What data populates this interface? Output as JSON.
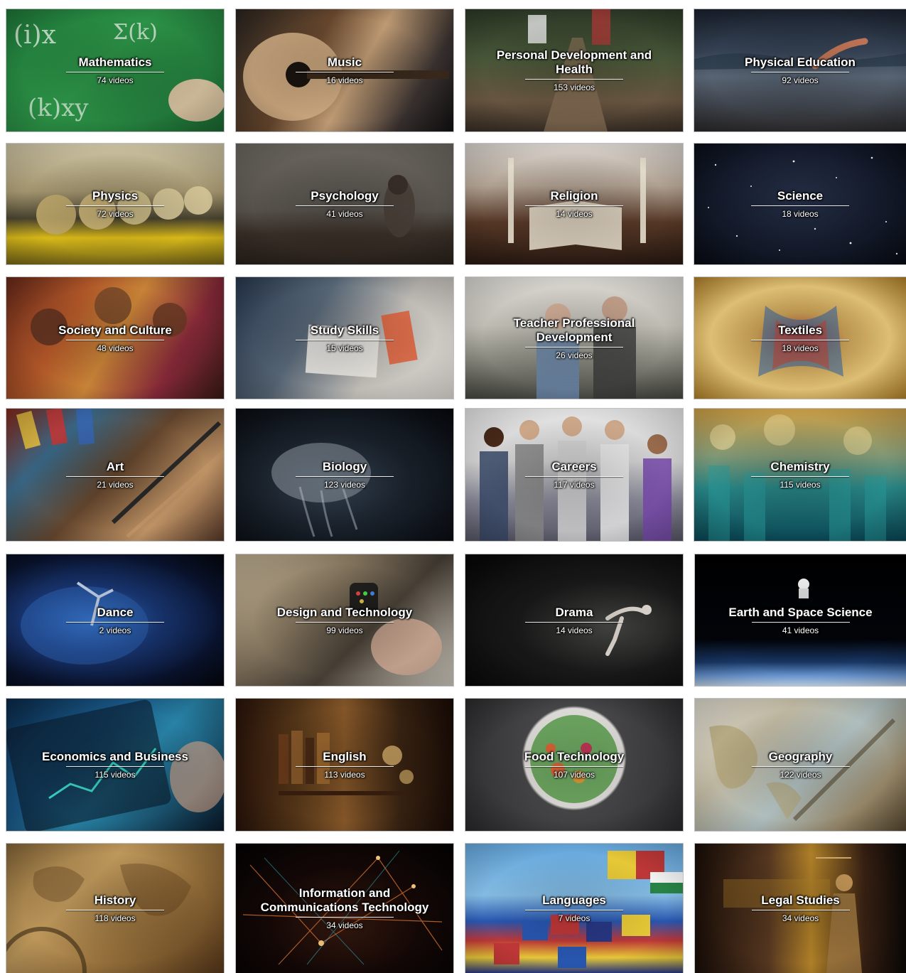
{
  "tiles": [
    {
      "title": "Mathematics",
      "count": "74 videos",
      "bg": "linear-gradient(135deg,#1f7a3a 0%,#2e9a4a 45%,#1c6a33 100%)",
      "accent": "#e9f5e9",
      "icon": "chalkboard-icon"
    },
    {
      "title": "Music",
      "count": "16 videos",
      "bg": "linear-gradient(120deg,#2b2520 0%,#6b4a2f 35%,#c9a37a 55%,#3a3230 80%,#121212 100%)",
      "accent": "#d8b48a",
      "icon": "guitar-icon"
    },
    {
      "title": "Personal Development and Health",
      "count": "153 videos",
      "bg": "linear-gradient(180deg,#2f3b28 0%,#4a5a3a 40%,#6e5a44 75%,#3a3026 100%)",
      "accent": "#b7c8a0",
      "icon": "runner-icon"
    },
    {
      "title": "Physical Education",
      "count": "92 videos",
      "bg": "linear-gradient(180deg,#1b2330 0%,#39475a 35%,#5d6a7a 55%,#2c2a2c 100%)",
      "accent": "#c97a5a",
      "icon": "swimmer-icon"
    },
    {
      "title": "Physics",
      "count": "72 videos",
      "bg": "linear-gradient(180deg,#d9cfae 0%,#a99a72 40%,#4a4430 62%,#e3c21a 78%,#7a6a18 100%)",
      "accent": "#f0d84a",
      "icon": "newtons-cradle-icon"
    },
    {
      "title": "Psychology",
      "count": "41 videos",
      "bg": "linear-gradient(180deg,#6f6a63 0%,#5a554f 55%,#3a3028 75%,#2a221c 100%)",
      "accent": "#9a8f80",
      "icon": "person-icon"
    },
    {
      "title": "Religion",
      "count": "14 videos",
      "bg": "linear-gradient(180deg,#e6e0da 0%,#b8a898 35%,#5a3a28 65%,#2a1a12 100%)",
      "accent": "#f2ead8",
      "icon": "book-icon"
    },
    {
      "title": "Science",
      "count": "18 videos",
      "bg": "radial-gradient(ellipse at 50% 45%,#2a3550 0%,#141b2c 55%,#080b14 100%)",
      "accent": "#ffffff",
      "icon": "star-icon"
    },
    {
      "title": "Society and Culture",
      "count": "48 videos",
      "bg": "linear-gradient(120deg,#6a2a1a 0%,#b85a2a 30%,#d28a3a 50%,#8a2a3a 75%,#3a1a14 100%)",
      "accent": "#e8b070",
      "icon": "people-icon"
    },
    {
      "title": "Study Skills",
      "count": "15 videos",
      "bg": "linear-gradient(120deg,#2a3a52 0%,#5a6a7a 35%,#c8c4be 65%,#e8e4de 100%)",
      "accent": "#e8623a",
      "icon": "notebook-icon"
    },
    {
      "title": "Teacher Professional Development",
      "count": "26 videos",
      "bg": "linear-gradient(180deg,#e4e2dc 0%,#c8c6bc 40%,#8a8a80 70%,#4a4a44 100%)",
      "accent": "#6a8ab0",
      "icon": "meeting-icon"
    },
    {
      "title": "Textiles",
      "count": "18 videos",
      "bg": "radial-gradient(ellipse at 50% 50%,#c84a3a 0%,#d2a85a 30%,#e8c87a 60%,#b8862a 100%)",
      "accent": "#3a6aa8",
      "icon": "fabric-icon"
    },
    {
      "title": "Art",
      "count": "21 videos",
      "bg": "linear-gradient(135deg,#8a2a1a 0%,#3a6a8a 25%,#6a4a30 50%,#c89a6a 75%,#5a3a2a 100%)",
      "accent": "#e8c040",
      "icon": "paintbrush-icon"
    },
    {
      "title": "Biology",
      "count": "123 videos",
      "bg": "radial-gradient(ellipse at 45% 55%,#3a4a5a 0%,#1a222c 45%,#06080c 100%)",
      "accent": "#dfe8f0",
      "icon": "jellyfish-icon"
    },
    {
      "title": "Careers",
      "count": "117 videos",
      "bg": "linear-gradient(180deg,#f2f2f2 0%,#d8d8d8 40%,#8a8a9a 70%,#5a5a6a 100%)",
      "accent": "#7a4ab0",
      "icon": "workers-icon"
    },
    {
      "title": "Chemistry",
      "count": "115 videos",
      "bg": "linear-gradient(180deg,#d8a84a 0%,#8aa07a 35%,#2a8a8a 60%,#0a4a58 100%)",
      "accent": "#f2e0a0",
      "icon": "test-tubes-icon"
    },
    {
      "title": "Dance",
      "count": "2 videos",
      "bg": "radial-gradient(ellipse at 40% 50%,#3a7ad8 0%,#1a3a7a 35%,#0a1430 70%,#04060c 100%)",
      "accent": "#8ab8ff",
      "icon": "dancer-icon"
    },
    {
      "title": "Design and Technology",
      "count": "99 videos",
      "bg": "linear-gradient(135deg,#c8b89a 0%,#8a7a62 35%,#4a4238 60%,#d8d2c6 100%)",
      "accent": "#f0e6d8",
      "icon": "smartwatch-icon"
    },
    {
      "title": "Drama",
      "count": "14 videos",
      "bg": "radial-gradient(ellipse at 65% 55%,#4a4a48 0%,#1a1a1a 45%,#050505 100%)",
      "accent": "#e8e0d8",
      "icon": "performer-icon"
    },
    {
      "title": "Earth and Space Science",
      "count": "41 videos",
      "bg": "linear-gradient(180deg,#000000 0%,#02040a 65%,#1a3a6a 82%,#6a9ad8 92%,#c8dcf2 100%)",
      "accent": "#ffffff",
      "icon": "astronaut-icon"
    },
    {
      "title": "Economics and Business",
      "count": "115 videos",
      "bg": "linear-gradient(135deg,#0a2a4a 0%,#1a5a8a 35%,#2a8ab0 55%,#0a1a2c 100%)",
      "accent": "#3ad8c8",
      "icon": "tablet-chart-icon"
    },
    {
      "title": "English",
      "count": "113 videos",
      "bg": "linear-gradient(90deg,#2a140a 0%,#5a3a1a 30%,#8a5a2a 50%,#3a2412 75%,#1a0c06 100%)",
      "accent": "#f2c87a",
      "icon": "bookshelf-icon"
    },
    {
      "title": "Food Technology",
      "count": "107 videos",
      "bg": "radial-gradient(circle at 50% 45%,#f2f2f0 0%,#e8e6e2 38%,#4a4a4c 40%,#2a2a2c 100%)",
      "accent": "#4a9a3a",
      "icon": "salad-icon"
    },
    {
      "title": "Geography",
      "count": "122 videos",
      "bg": "linear-gradient(135deg,#e8e4d8 0%,#c8c0a8 30%,#b8c8c8 55%,#9a8a6a 80%,#5a4a32 100%)",
      "accent": "#c84a4a",
      "icon": "globe-icon"
    },
    {
      "title": "History",
      "count": "118 videos",
      "bg": "linear-gradient(135deg,#8a6a3a 0%,#c8a060 35%,#a07840 60%,#5a3a1a 100%)",
      "accent": "#3a2a14",
      "icon": "map-icon"
    },
    {
      "title": "Information and Communications Technology",
      "count": "34 videos",
      "bg": "radial-gradient(ellipse at 50% 60%,#3a1a10 0%,#140806 50%,#020202 100%)",
      "accent": "#ff8a3a",
      "icon": "network-icon"
    },
    {
      "title": "Languages",
      "count": "7 videos",
      "bg": "linear-gradient(180deg,#6ab0e8 0%,#8ac4ee 40%,#2a5ab8 60%,#c83a3a 75%,#f2d23a 88%,#2a3a8a 100%)",
      "accent": "#ffffff",
      "icon": "flags-icon"
    },
    {
      "title": "Legal Studies",
      "count": "34 videos",
      "bg": "linear-gradient(90deg,#1a0e08 0%,#5a3a22 35%,#b8862a 55%,#3a2214 80%,#0c0806 100%)",
      "accent": "#d8b070",
      "icon": "justice-statue-icon"
    }
  ]
}
